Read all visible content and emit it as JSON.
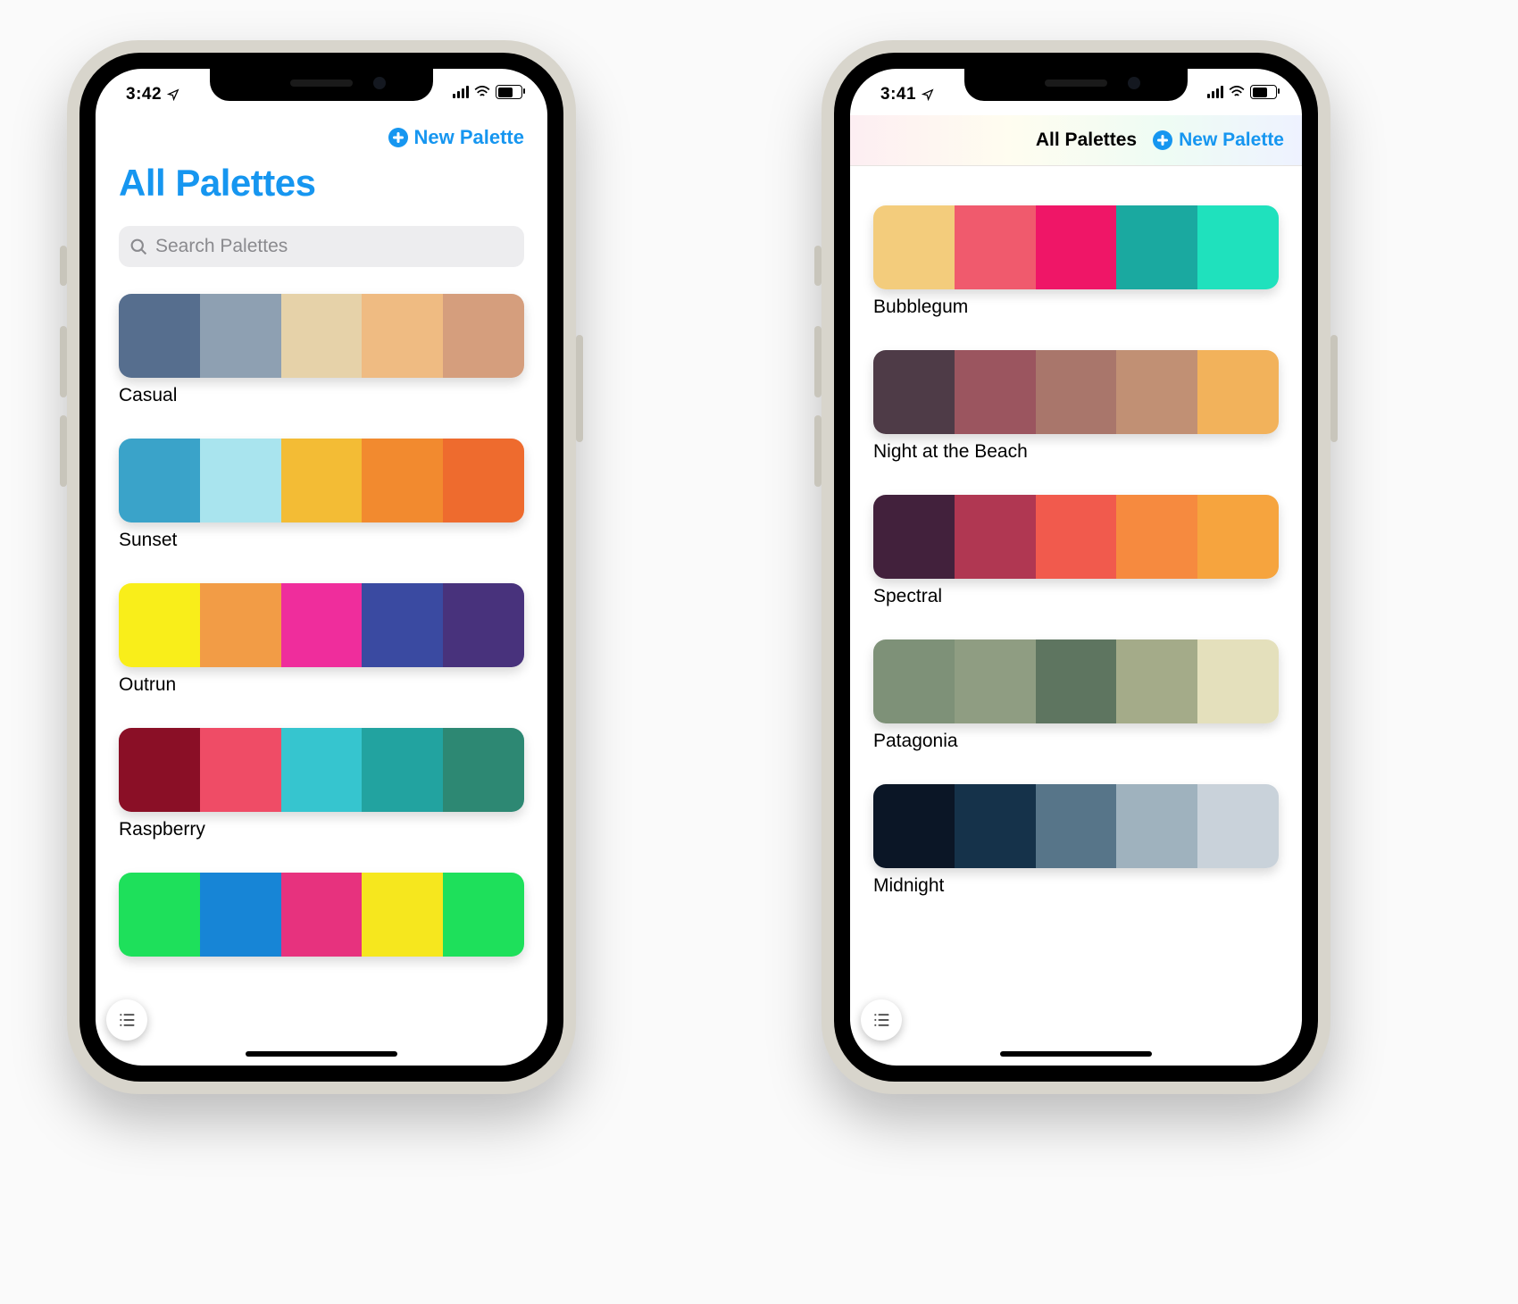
{
  "accent": "#1696f0",
  "left_phone": {
    "status": {
      "time": "3:42"
    },
    "header": {
      "title": "All Palettes",
      "new_label": "New Palette",
      "search_placeholder": "Search Palettes"
    },
    "palettes": [
      {
        "name": "Casual",
        "colors": [
          "#566e8e",
          "#8ea0b2",
          "#e6d2a9",
          "#efbb82",
          "#d59e7d"
        ]
      },
      {
        "name": "Sunset",
        "colors": [
          "#3aa3c9",
          "#a9e4ee",
          "#f3bc35",
          "#f28a2f",
          "#ee6b2e"
        ]
      },
      {
        "name": "Outrun",
        "colors": [
          "#f9ee1a",
          "#f29c46",
          "#ef2d9c",
          "#3a4aa1",
          "#48327c"
        ]
      },
      {
        "name": "Raspberry",
        "colors": [
          "#8a0f26",
          "#ef4c66",
          "#36c5cf",
          "#22a3a0",
          "#2d8873"
        ]
      },
      {
        "name": "",
        "colors": [
          "#1ee05b",
          "#1785d6",
          "#e7327e",
          "#f6e71e",
          "#1ee05b"
        ]
      }
    ]
  },
  "right_phone": {
    "status": {
      "time": "3:41"
    },
    "header": {
      "title": "All Palettes",
      "new_label": "New Palette"
    },
    "palettes": [
      {
        "name": "Bubblegum",
        "colors": [
          "#f3cc7c",
          "#f05a6d",
          "#ef1667",
          "#1aa9a0",
          "#1fe1bd"
        ]
      },
      {
        "name": "Night at the Beach",
        "colors": [
          "#4e3b47",
          "#9b555f",
          "#a9766b",
          "#c19074",
          "#f2b25b"
        ]
      },
      {
        "name": "Spectral",
        "colors": [
          "#42213c",
          "#b03752",
          "#f15a4d",
          "#f68a3f",
          "#f6a43e"
        ]
      },
      {
        "name": "Patagonia",
        "colors": [
          "#7e9178",
          "#8f9d82",
          "#5e7560",
          "#a4ab89",
          "#e4e0bc"
        ]
      },
      {
        "name": "Midnight",
        "colors": [
          "#0b1626",
          "#15324a",
          "#577589",
          "#9fb2be",
          "#c9d2da"
        ]
      }
    ]
  }
}
